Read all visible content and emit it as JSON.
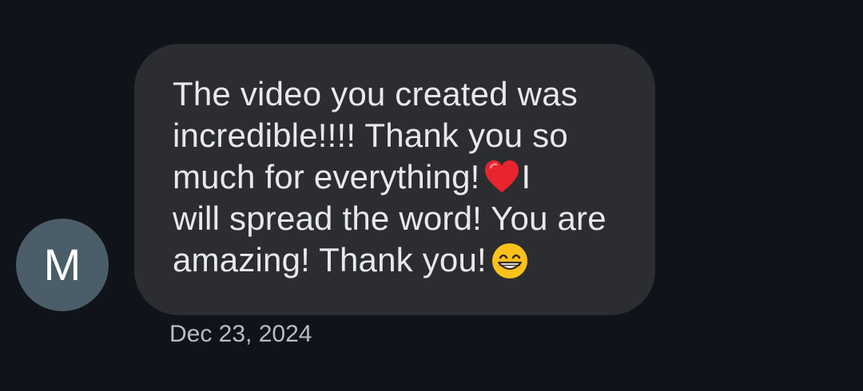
{
  "avatar": {
    "initial": "M",
    "color": "#4a5d68"
  },
  "message": {
    "line1": "The video you created was",
    "line2": "incredible!!!! Thank you so",
    "line3_a": "much for everything!",
    "line3_b": "I",
    "line4": "will spread the word! You are",
    "line5": "amazing! Thank you!",
    "emojis": [
      "red-heart",
      "grinning-face-with-smiling-eyes"
    ]
  },
  "timestamp": "Dec 23, 2024",
  "colors": {
    "background": "#10131a",
    "bubble": "#2b2d31",
    "text": "#e8e9ec",
    "timestamp": "#b9bcc2"
  }
}
